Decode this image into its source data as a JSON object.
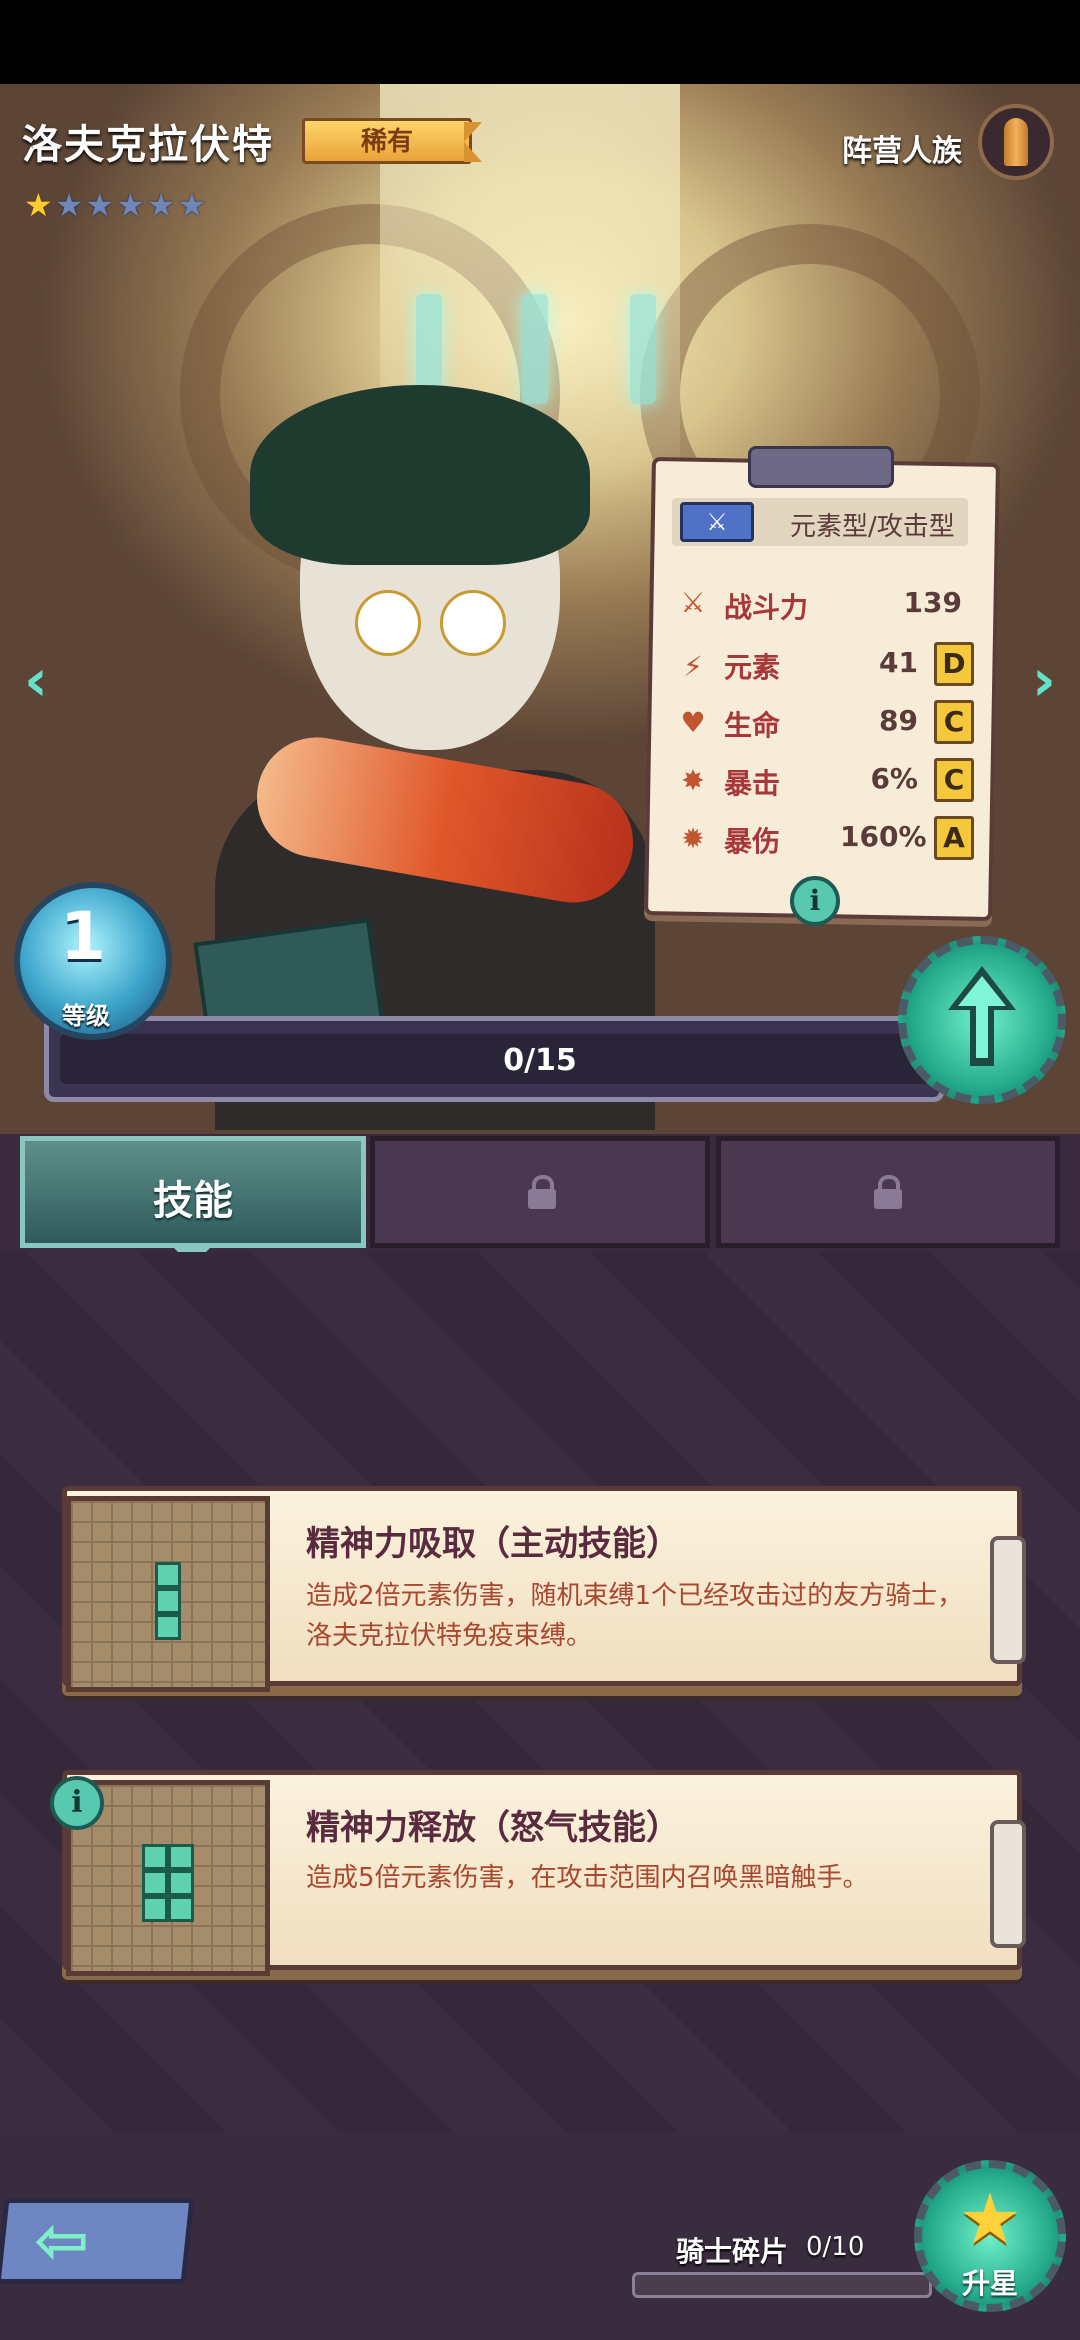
{
  "hero": {
    "name": "洛夫克拉伏特",
    "rarity": "稀有",
    "stars_filled": 1,
    "stars_total": 6,
    "faction_label": "阵营人族"
  },
  "stats_card": {
    "type_label": "元素型/攻击型",
    "type_icon": "sword-icon",
    "rows": [
      {
        "icon": "power-icon",
        "name": "战斗力",
        "value": "139",
        "grade": ""
      },
      {
        "icon": "lightning-icon",
        "name": "元素",
        "value": "41",
        "grade": "D"
      },
      {
        "icon": "heart-icon",
        "name": "生命",
        "value": "89",
        "grade": "C"
      },
      {
        "icon": "crit-icon",
        "name": "暴击",
        "value": "6%",
        "grade": "C"
      },
      {
        "icon": "crit-damage-icon",
        "name": "暴伤",
        "value": "160%",
        "grade": "A"
      }
    ],
    "info_glyph": "i"
  },
  "level": {
    "value": "1",
    "label": "等级",
    "exp_text": "0/15"
  },
  "tabs": {
    "skills_label": "技能"
  },
  "skills": [
    {
      "title": "精神力吸取（主动技能）",
      "desc": "造成2倍元素伤害，随机束缚1个已经攻击过的友方骑士，洛夫克拉伏特免疫束缚。"
    },
    {
      "title": "精神力释放（怒气技能）",
      "desc": "造成5倍元素伤害，在攻击范围内召唤黑暗触手。",
      "info_glyph": "i"
    }
  ],
  "bottom": {
    "shard_label": "骑士碎片",
    "shard_count": "0/10",
    "star_up_label": "升星"
  },
  "colors": {
    "accent_teal": "#58c8b0",
    "rarity_gold": "#f2b84a",
    "grade_gold": "#f4c83a",
    "stat_red": "#a7373a"
  }
}
